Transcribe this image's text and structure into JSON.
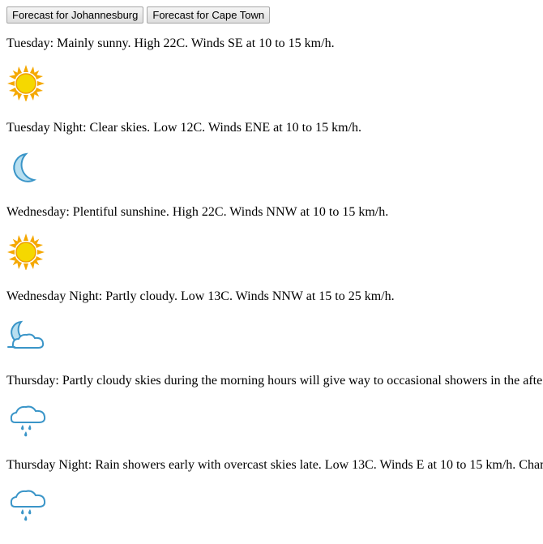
{
  "buttons": {
    "johannesburg": "Forecast for Johannesburg",
    "cape_town": "Forecast for Cape Town"
  },
  "forecast": [
    {
      "text": "Tuesday: Mainly sunny. High 22C. Winds SE at 10 to 15 km/h.",
      "icon": "sun-icon"
    },
    {
      "text": "Tuesday Night: Clear skies. Low 12C. Winds ENE at 10 to 15 km/h.",
      "icon": "moon-icon"
    },
    {
      "text": "Wednesday: Plentiful sunshine. High 22C. Winds NNW at 10 to 15 km/h.",
      "icon": "sun-icon"
    },
    {
      "text": "Wednesday Night: Partly cloudy. Low 13C. Winds NNW at 15 to 25 km/h.",
      "icon": "moon-cloud-icon"
    },
    {
      "text": "Thursday: Partly cloudy skies during the morning hours will give way to occasional showers in the afte",
      "icon": "rain-cloud-icon"
    },
    {
      "text": "Thursday Night: Rain showers early with overcast skies late. Low 13C. Winds E at 10 to 15 km/h. Chan",
      "icon": "rain-cloud-icon"
    }
  ],
  "colors": {
    "sun": "#f5c400",
    "moon": "#4aa0d0",
    "cloud": "#5fb0dc"
  }
}
